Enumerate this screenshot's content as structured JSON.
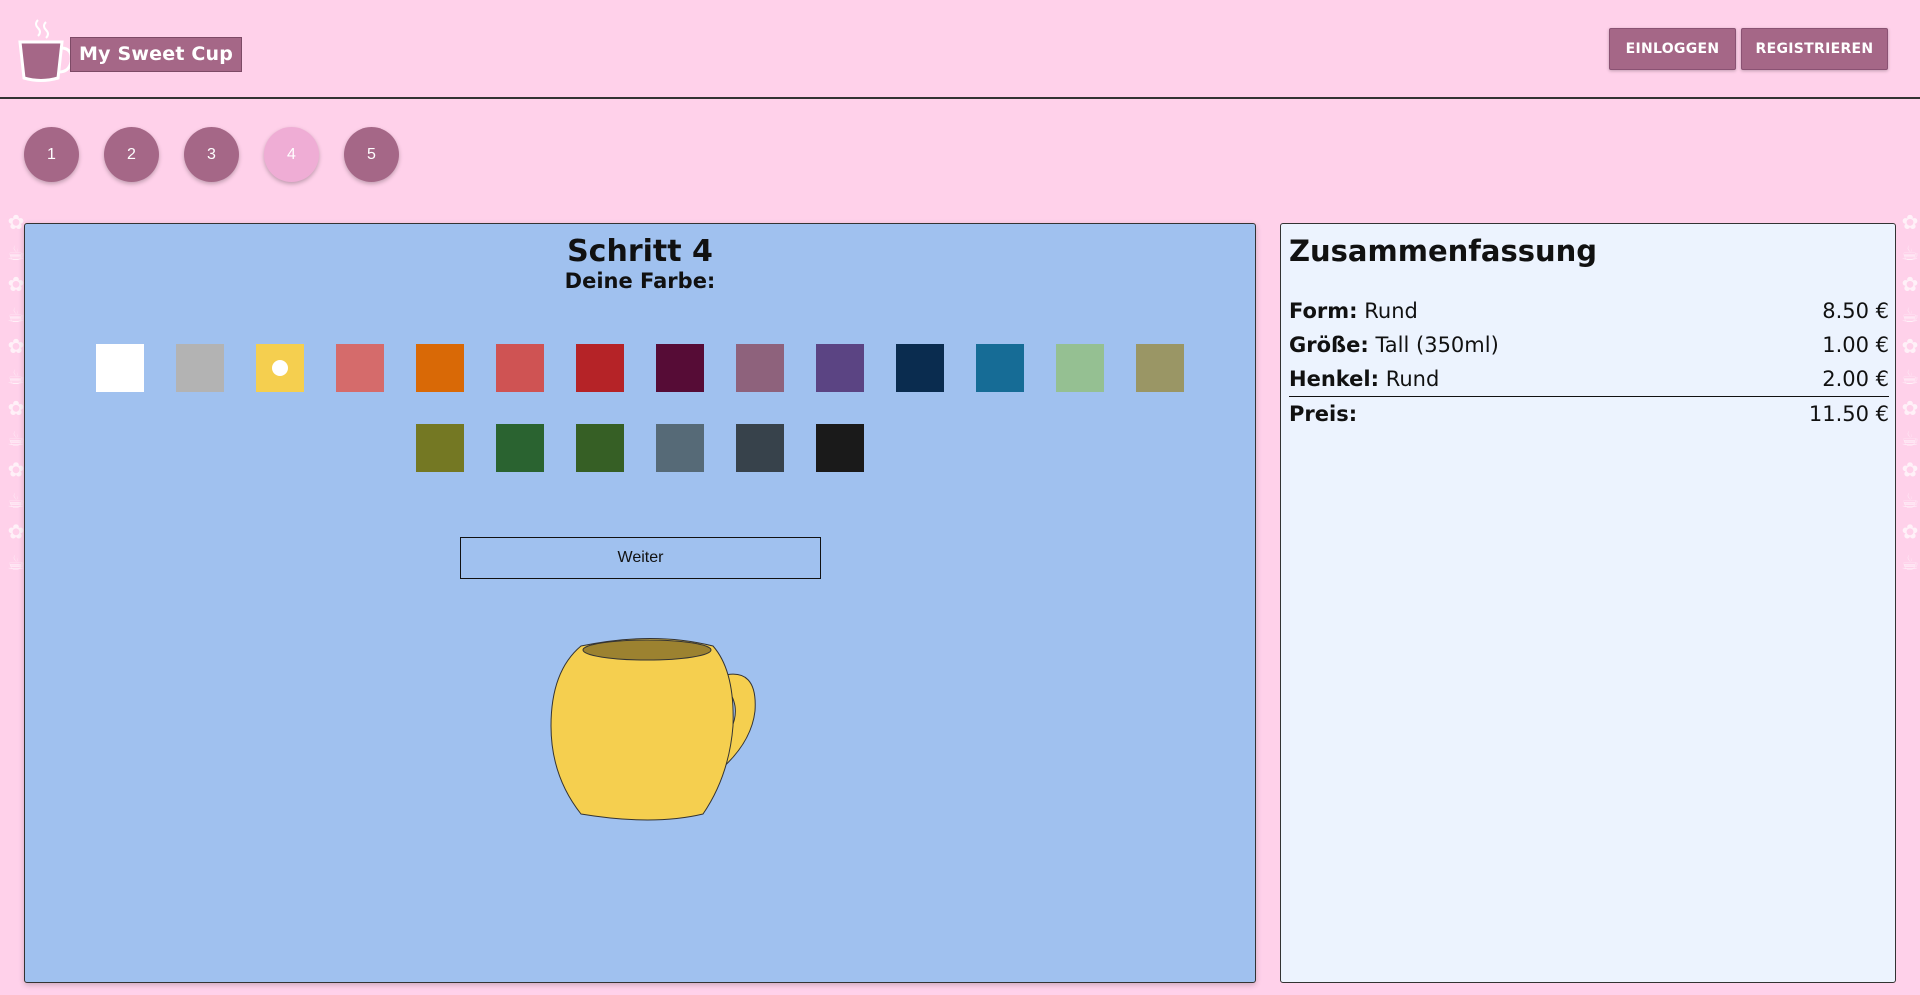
{
  "header": {
    "logo_text": "My Sweet Cup",
    "login_label": "Einloggen",
    "register_label": "Registrieren"
  },
  "steps": [
    "1",
    "2",
    "3",
    "4",
    "5"
  ],
  "active_step": "4",
  "configurator": {
    "title": "Schritt 4",
    "subtitle": "Deine Farbe:",
    "continue_label": "Weiter",
    "selected_color": "#f5cf4f",
    "colors": [
      "#ffffff",
      "#b3b3b3",
      "#f5cf4f",
      "#d56b6b",
      "#d96906",
      "#cf5353",
      "#b52327",
      "#560c36",
      "#8e627c",
      "#5b4483",
      "#0a2c4f",
      "#166c96",
      "#95c092",
      "#9a9665",
      "#747823",
      "#2a6330",
      "#365f25",
      "#566a77",
      "#37424b",
      "#1a1a1a"
    ]
  },
  "summary": {
    "title": "Zusammenfassung",
    "rows": [
      {
        "label": "Form:",
        "value": "Rund",
        "price": "8.50 €"
      },
      {
        "label": "Größe:",
        "value": "Tall (350ml)",
        "price": "1.00 €"
      },
      {
        "label": "Henkel:",
        "value": "Rund",
        "price": "2.00 €"
      }
    ],
    "total": {
      "label": "Preis:",
      "price": "11.50 €"
    }
  },
  "colors": {
    "page_bg": "#ffd1ea",
    "accent": "#a56787",
    "main_panel_bg": "#a0c1ef",
    "summary_bg": "#ecf3fe"
  }
}
